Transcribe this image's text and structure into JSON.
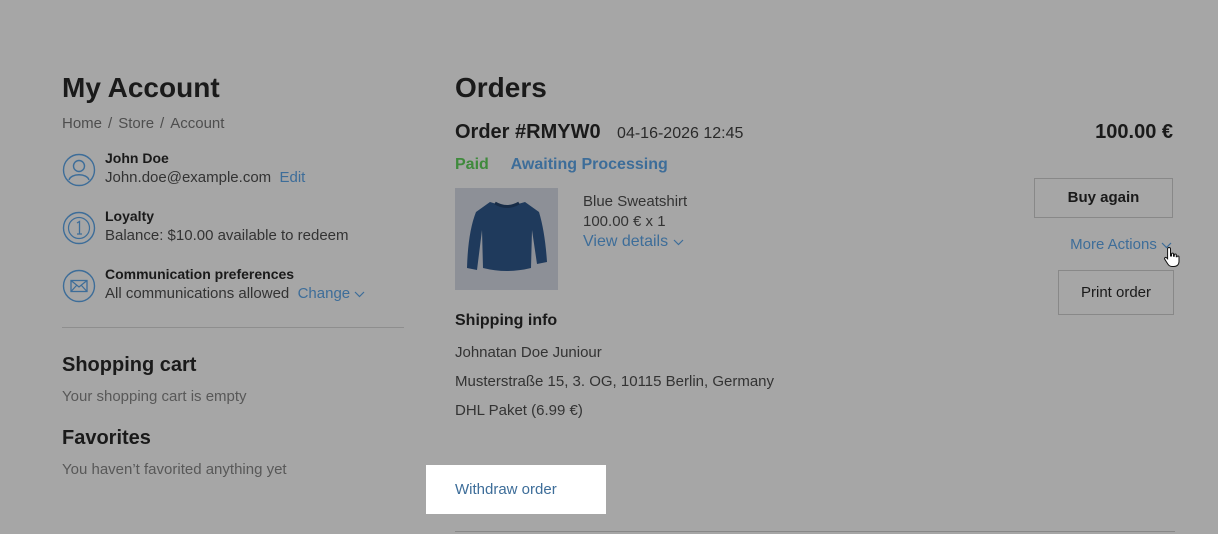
{
  "account": {
    "title": "My Account",
    "breadcrumb": [
      "Home",
      "Store",
      "Account"
    ],
    "profile": {
      "name": "John Doe",
      "email": "John.doe@example.com",
      "edit_label": "Edit",
      "icon": "user-icon"
    },
    "loyalty": {
      "title": "Loyalty",
      "text": "Balance: $10.00 available to redeem",
      "icon": "coin-icon"
    },
    "communication": {
      "title": "Communication preferences",
      "text": "All communications allowed",
      "change_label": "Change",
      "icon": "envelope-icon"
    },
    "cart": {
      "title": "Shopping cart",
      "text": "Your shopping cart is empty"
    },
    "favorites": {
      "title": "Favorites",
      "text": "You haven’t favorited anything yet"
    }
  },
  "orders": {
    "title": "Orders",
    "order": {
      "number": "Order #RMYW0",
      "date": "04-16-2026 12:45",
      "total": "100.00 €",
      "status_payment": "Paid",
      "status_processing": "Awaiting Processing",
      "product": {
        "name": "Blue Sweatshirt",
        "price_qty": "100.00 € x 1",
        "details_label": "View details"
      },
      "actions": {
        "buy_again": "Buy again",
        "more_actions": "More Actions",
        "print": "Print order",
        "withdraw": "Withdraw order"
      },
      "shipping": {
        "title": "Shipping info",
        "name": "Johnatan Doe Juniour",
        "address": "Musterstraße 15, 3. OG, 10115 Berlin, Germany",
        "method": "DHL Paket (6.99 €)"
      }
    }
  },
  "colors": {
    "link": "#3d6d99",
    "paid": "#3f8a3c",
    "overlay": "#a6a6a6",
    "highlight": "#ffffff"
  }
}
